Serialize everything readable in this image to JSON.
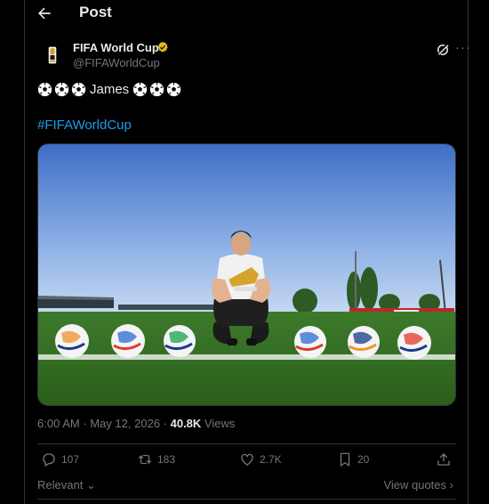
{
  "header": {
    "title": "Post",
    "back_icon": "arrow-left-icon"
  },
  "author": {
    "name": "FIFA World Cup",
    "handle": "@FIFAWorldCup",
    "verified_color": "#e2b719",
    "avatar_icon": "world-cup-trophy-icon"
  },
  "tweet": {
    "text": "James",
    "hashtag": "#FIFAWorldCup",
    "link_color": "#1d9bf0"
  },
  "media": {
    "description_icon": "photo"
  },
  "meta": {
    "time": "6:00 AM",
    "sep1": " · ",
    "date": "May 12, 2026",
    "sep2": " · ",
    "views_count": "40.8K",
    "views_label": " Views"
  },
  "actions": {
    "replies": "107",
    "reposts": "183",
    "likes": "2.7K",
    "bookmarks": "20"
  },
  "footer": {
    "sort_label": "Relevant",
    "view_quotes": "View quotes"
  }
}
